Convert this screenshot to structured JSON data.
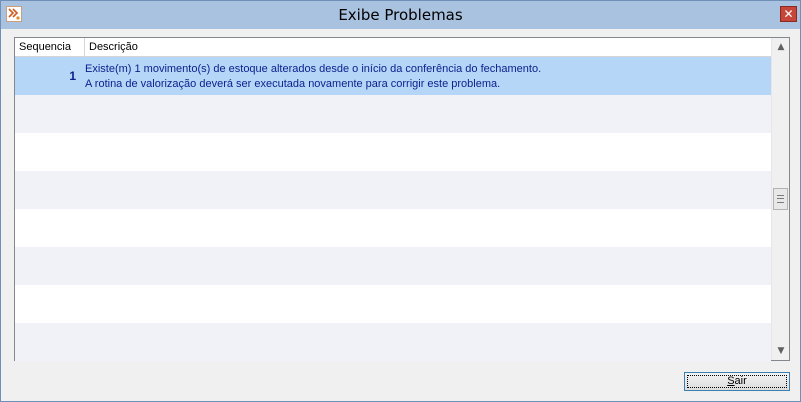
{
  "window": {
    "title": "Exibe Problemas",
    "close_glyph": "✕",
    "icon": "app-logo-icon"
  },
  "grid": {
    "columns": [
      "Sequencia",
      "Descrição"
    ],
    "rows": [
      {
        "sequencia": "1",
        "descricao_line1": "Existe(m) 1 movimento(s) de estoque alterados desde o início da conferência do fechamento.",
        "descricao_line2": "A rotina de valorização deverá ser executada novamente para corrigir este problema."
      }
    ],
    "selected_row_color": "#b5d6f7",
    "alt_row_color": "#f1f2f7"
  },
  "scrollbar": {
    "up_glyph": "▲",
    "down_glyph": "▼"
  },
  "footer": {
    "exit_label_first": "S",
    "exit_label_rest": "air"
  }
}
